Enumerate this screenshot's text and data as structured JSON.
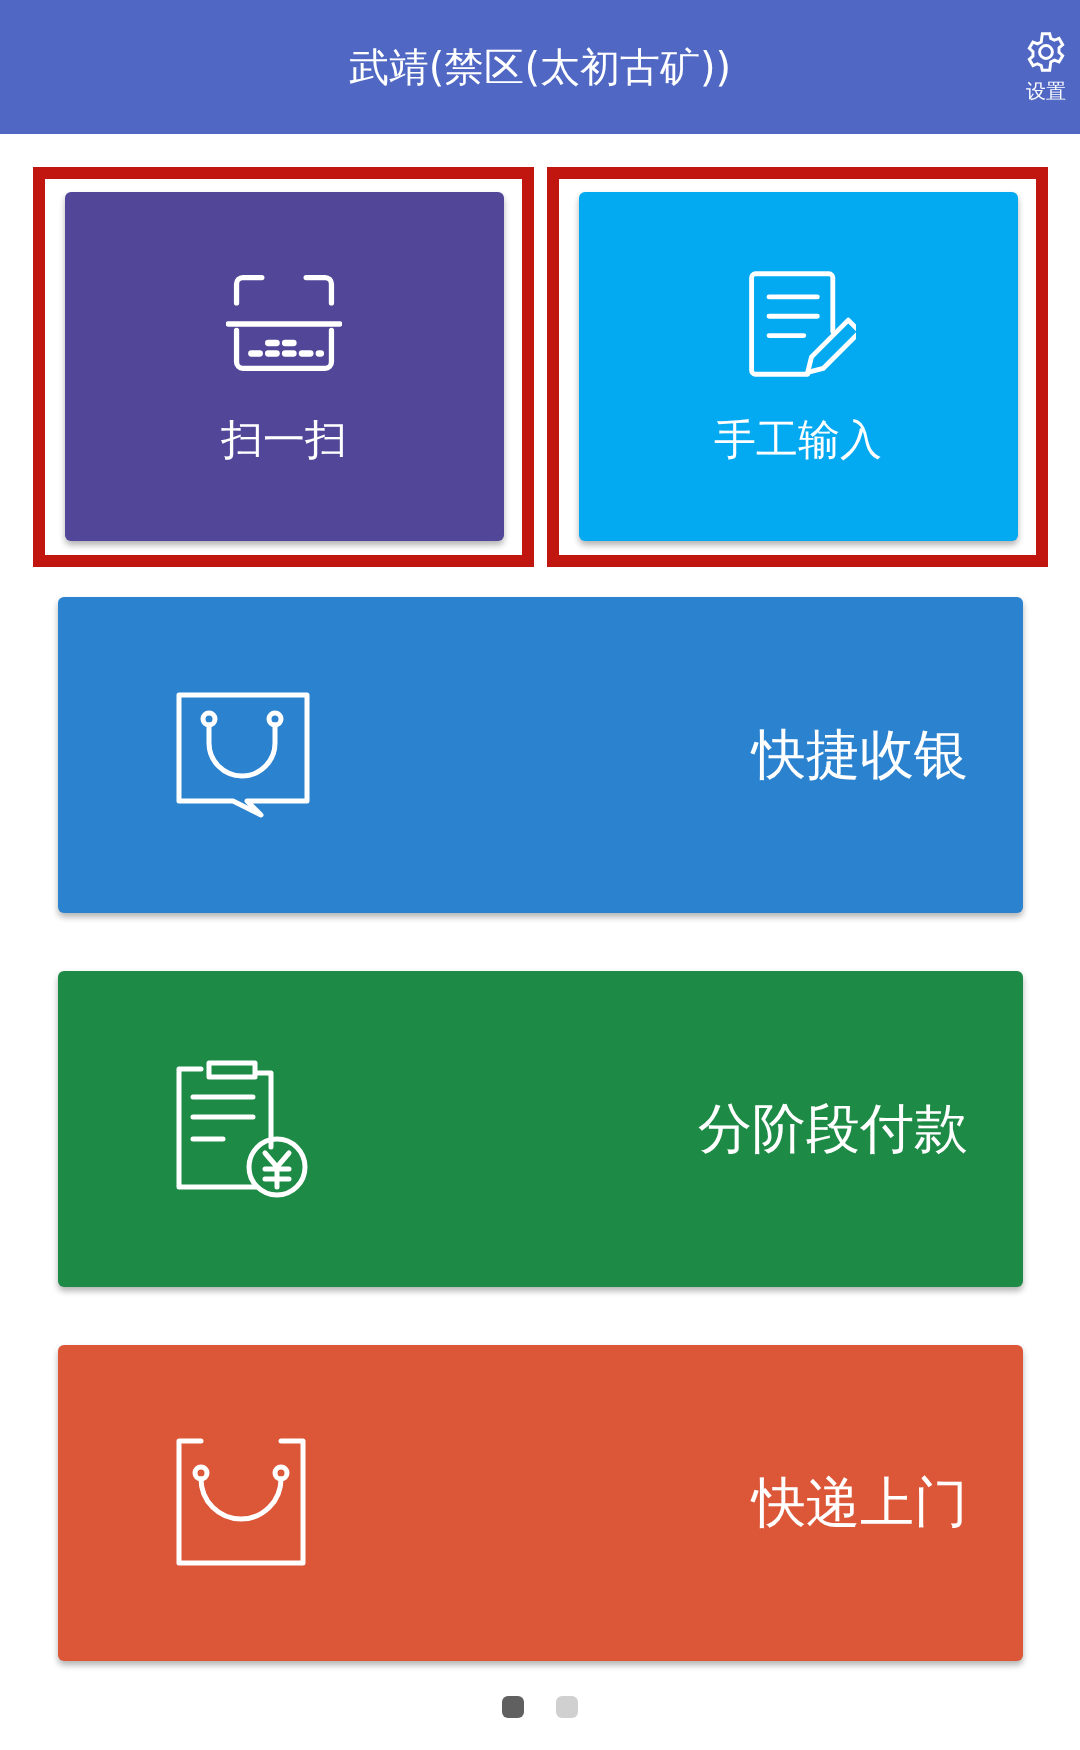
{
  "header": {
    "title": "武靖(禁区(太初古矿))",
    "settings_label": "设置"
  },
  "tiles": [
    {
      "kind": "scan",
      "label": "扫一扫",
      "color": "#514698",
      "highlighted": true
    },
    {
      "kind": "edit",
      "label": "手工输入",
      "color": "#03a9f1",
      "highlighted": true
    }
  ],
  "cards": [
    {
      "kind": "cashier",
      "label": "快捷收银",
      "color": "#2b82cf"
    },
    {
      "kind": "installment",
      "label": "分阶段付款",
      "color": "#1d8a45"
    },
    {
      "kind": "delivery",
      "label": "快递上门",
      "color": "#dc5638"
    }
  ],
  "pager": [
    {
      "selected": true
    },
    {
      "selected": false
    }
  ]
}
